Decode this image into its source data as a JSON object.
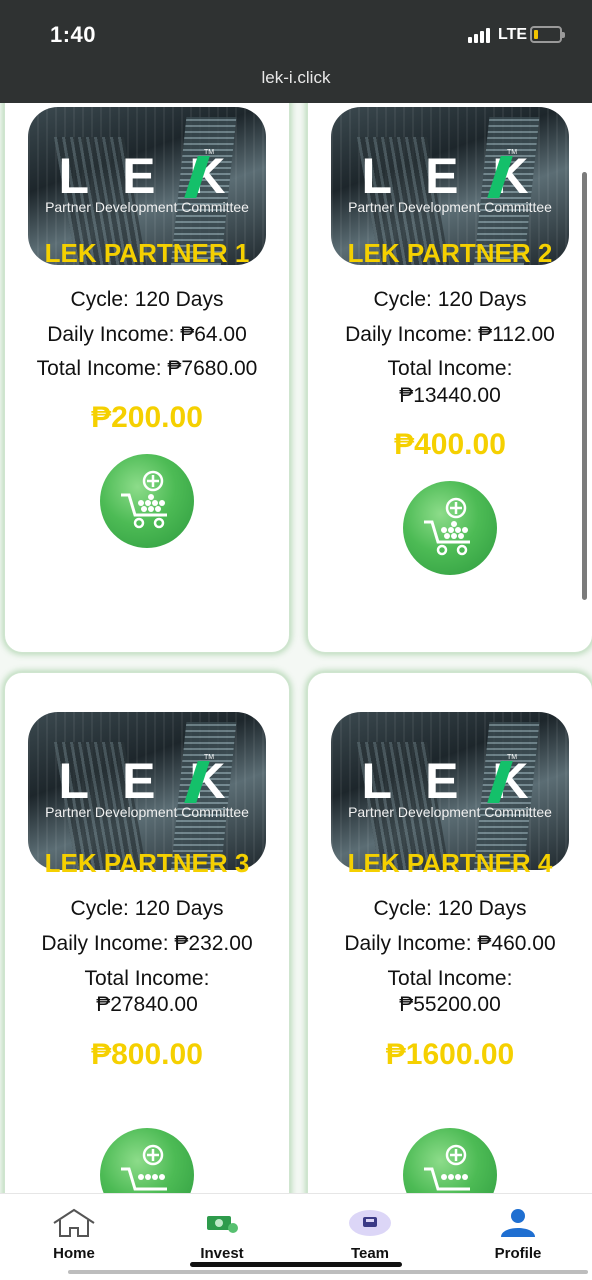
{
  "status_bar": {
    "time": "1:40",
    "network": "LTE",
    "url": "lek-i.click"
  },
  "banner": {
    "logo_text": "LEK",
    "trademark": "TM",
    "tagline": "Partner Development Committee"
  },
  "plans": [
    {
      "title": "LEK PARTNER 1",
      "cycle": "Cycle: 120 Days",
      "daily": "Daily Income: ₱64.00",
      "total_line1": "Total Income: ₱7680.00",
      "total_line2": "",
      "price": "₱200.00"
    },
    {
      "title": "LEK PARTNER 2",
      "cycle": "Cycle: 120 Days",
      "daily": "Daily Income: ₱112.00",
      "total_line1": "Total Income:",
      "total_line2": "₱13440.00",
      "price": "₱400.00"
    },
    {
      "title": "LEK PARTNER 3",
      "cycle": "Cycle: 120 Days",
      "daily": "Daily Income: ₱232.00",
      "total_line1": "Total Income:",
      "total_line2": "₱27840.00",
      "price": "₱800.00"
    },
    {
      "title": "LEK PARTNER 4",
      "cycle": "Cycle: 120 Days",
      "daily": "Daily Income: ₱460.00",
      "total_line1": "Total Income:",
      "total_line2": "₱55200.00",
      "price": "₱1600.00"
    }
  ],
  "nav": {
    "home": "Home",
    "invest": "Invest",
    "team": "Team",
    "profile": "Profile"
  },
  "colors": {
    "accent_yellow": "#f5d000",
    "cart_green": "#4dbb55",
    "profile_blue": "#1f6fd1",
    "status_bar_bg": "#2f3232"
  }
}
